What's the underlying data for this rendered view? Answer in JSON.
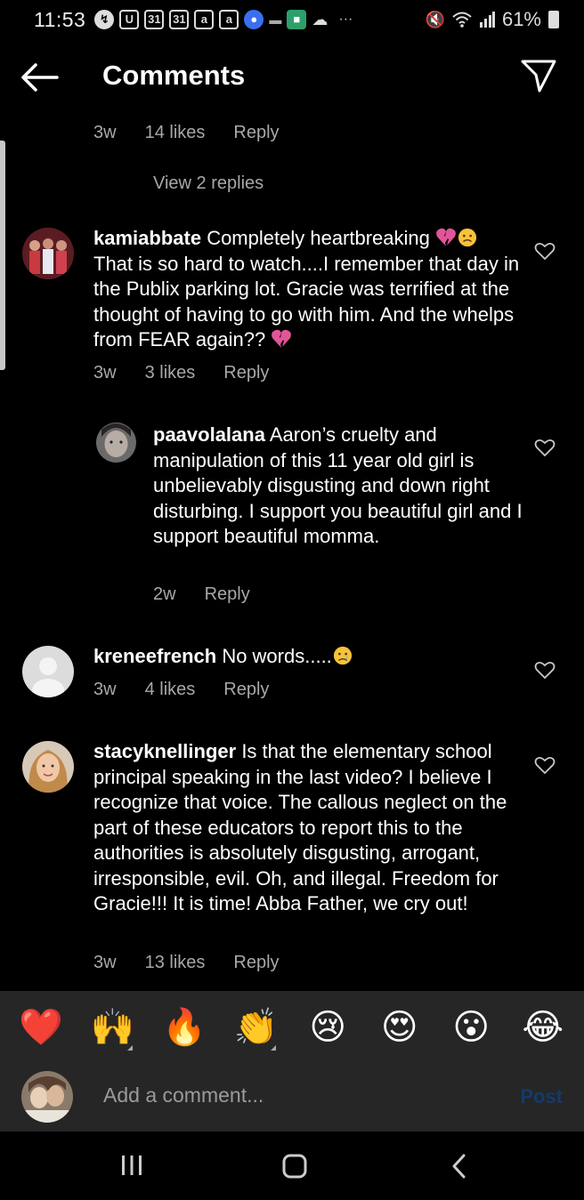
{
  "status_bar": {
    "time": "11:53",
    "battery": "61%",
    "notification_icons": [
      "messenger-icon",
      "u-app-icon",
      "calendar-31-icon",
      "calendar-31-icon",
      "a-app-icon",
      "a-app-icon",
      "blue-app-icon",
      "dash-icon",
      "green-app-icon",
      "cloud-icon"
    ],
    "more": "···"
  },
  "header": {
    "title": "Comments"
  },
  "top_meta": {
    "time": "3w",
    "likes": "14 likes",
    "reply": "Reply"
  },
  "view_replies": "View 2 replies",
  "comments": [
    {
      "username": "kamiabbate",
      "text": "Completely heartbreaking",
      "text2": "That is so hard to watch....I remember that day in the Publix parking lot.  Gracie was terrified at the thought of having to go with him.  And the whelps from FEAR again??",
      "time": "3w",
      "likes": "3 likes",
      "reply": "Reply"
    },
    {
      "username": "paavolalana",
      "text": "Aaron’s cruelty and manipulation of this 11 year old girl is unbelievably disgusting and down right disturbing. I support you beautiful girl and I support  beautiful momma.",
      "time": "2w",
      "reply": "Reply"
    },
    {
      "username": "kreneefrench",
      "text": "No words.....",
      "time": "3w",
      "likes": "4 likes",
      "reply": "Reply"
    },
    {
      "username": "stacyknellinger",
      "text": "Is that the elementary school principal speaking in the last video? I believe I recognize that voice.  The callous neglect on the part of these educators to report this to the authorities is absolutely disgusting, arrogant, irresponsible, evil.  Oh, and illegal.  Freedom for Gracie!!! It is time! Abba Father, we cry out!",
      "time": "3w",
      "likes": "13 likes",
      "reply": "Reply"
    }
  ],
  "emoji_bar": [
    "❤️",
    "🙌",
    "🔥",
    "👏",
    "😢",
    "😍",
    "😮",
    "😂"
  ],
  "comment_box": {
    "placeholder": "Add a comment...",
    "post": "Post"
  },
  "colors": {
    "background": "#000000",
    "secondary_text": "#a8a8a8",
    "bar_background": "#262626"
  }
}
